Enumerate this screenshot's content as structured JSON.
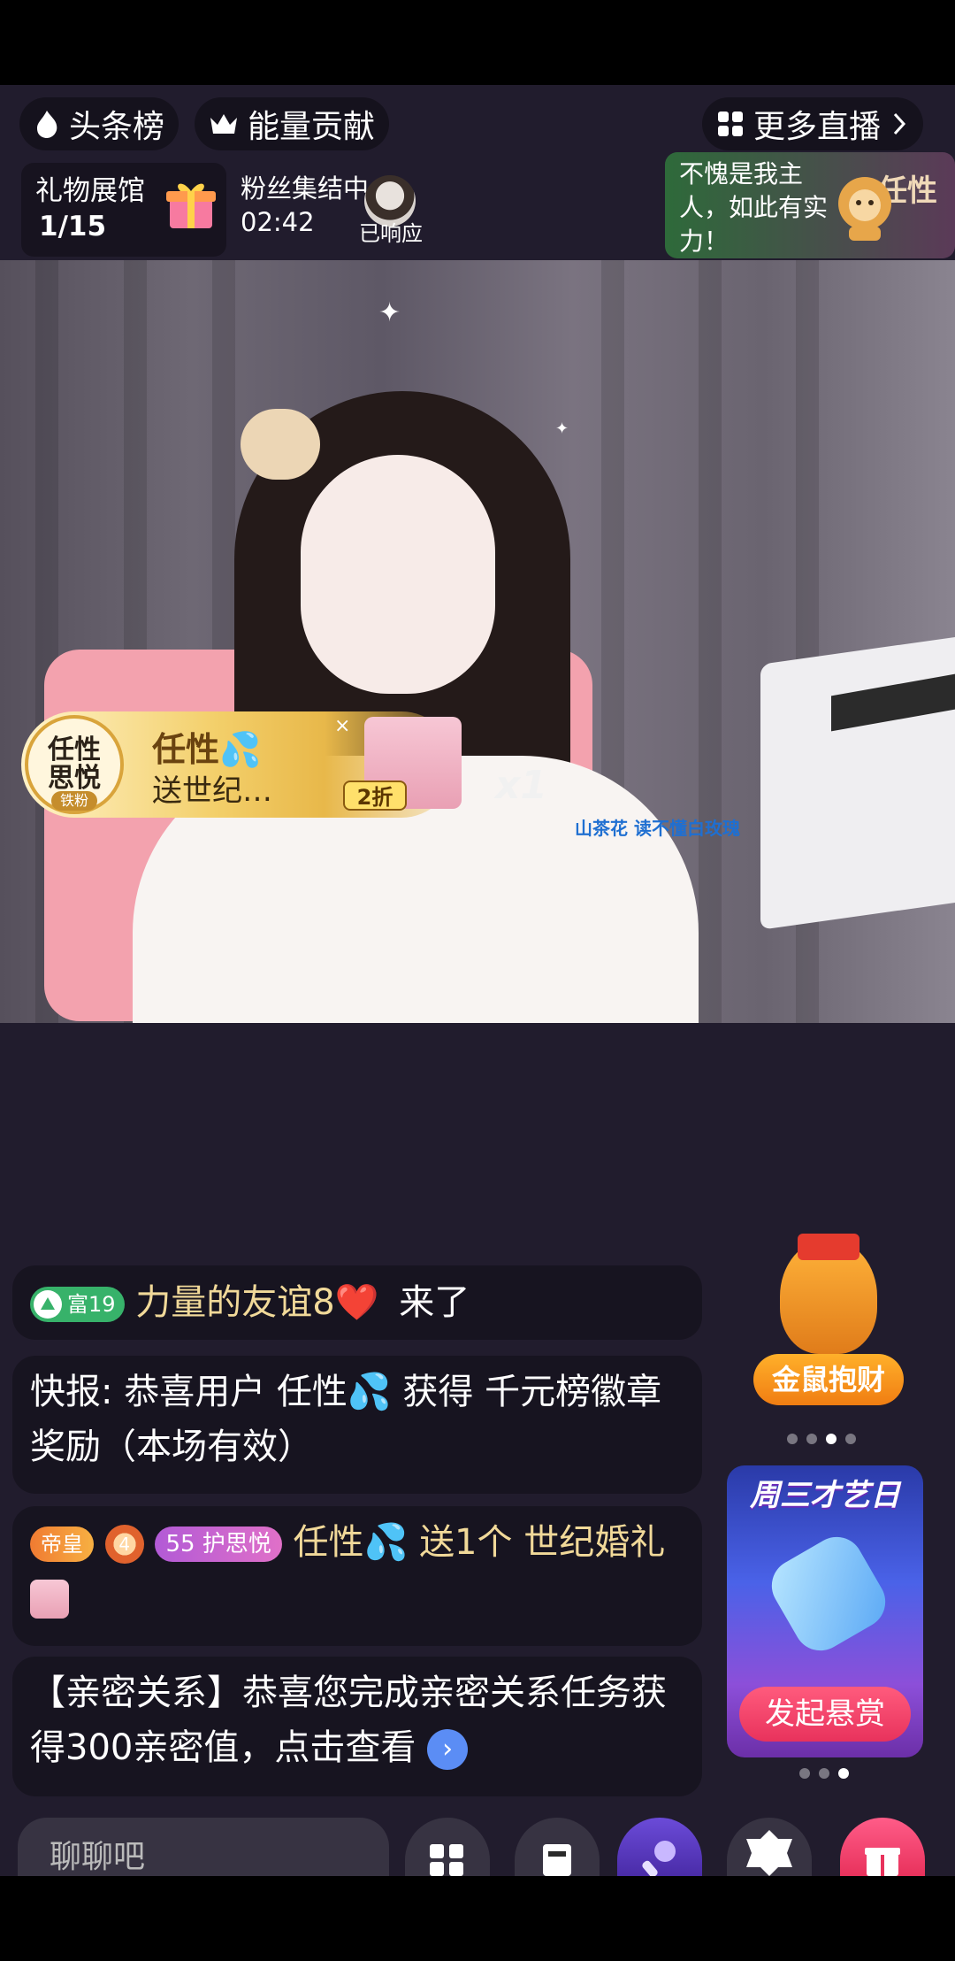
{
  "topbar": {
    "headline_label": "头条榜",
    "energy_label": "能量贡献",
    "more_live_label": "更多直播"
  },
  "gift_hall": {
    "title": "礼物展馆",
    "count": "1/15"
  },
  "fans_gather": {
    "title": "粉丝集结中",
    "timer": "02:42",
    "responded": "已响应"
  },
  "comment_bubble": {
    "text": "不愧是我主人，如此有实力！",
    "name": "任性"
  },
  "gift_banner": {
    "badge_line1": "任性",
    "badge_line2": "思悦",
    "badge_tag": "铁粉",
    "sender": "任性💦",
    "text": "送世纪…",
    "discount": "2折",
    "multiplier": "x1"
  },
  "video_caption": "山茶花  读不懂白玫瑰",
  "chat": [
    {
      "level": "富19",
      "user": "力量的友谊8❤️",
      "action": "来了"
    },
    {
      "text": "快报: 恭喜用户 任性💦 获得 千元榜徽章奖励（本场有效）"
    },
    {
      "tag1": "帝皇",
      "tag2": "4",
      "tag3_num": "55",
      "tag3_label": "护思悦",
      "user": "任性💦",
      "action": "送1个",
      "gift": "世纪婚礼"
    },
    {
      "text": "【亲密关系】恭喜您完成亲密关系任务获得300亲密值，点击查看"
    }
  ],
  "widgets": {
    "jinshu_label": "金鼠抱财",
    "reward_title": "周三才艺日",
    "reward_button": "发起悬赏"
  },
  "bottom": {
    "chat_placeholder": "聊聊吧"
  },
  "colors": {
    "background": "#211c2d",
    "accent_gold": "#f1d999",
    "green_badge": "#37b26a",
    "reward_button": "#e8325c"
  }
}
